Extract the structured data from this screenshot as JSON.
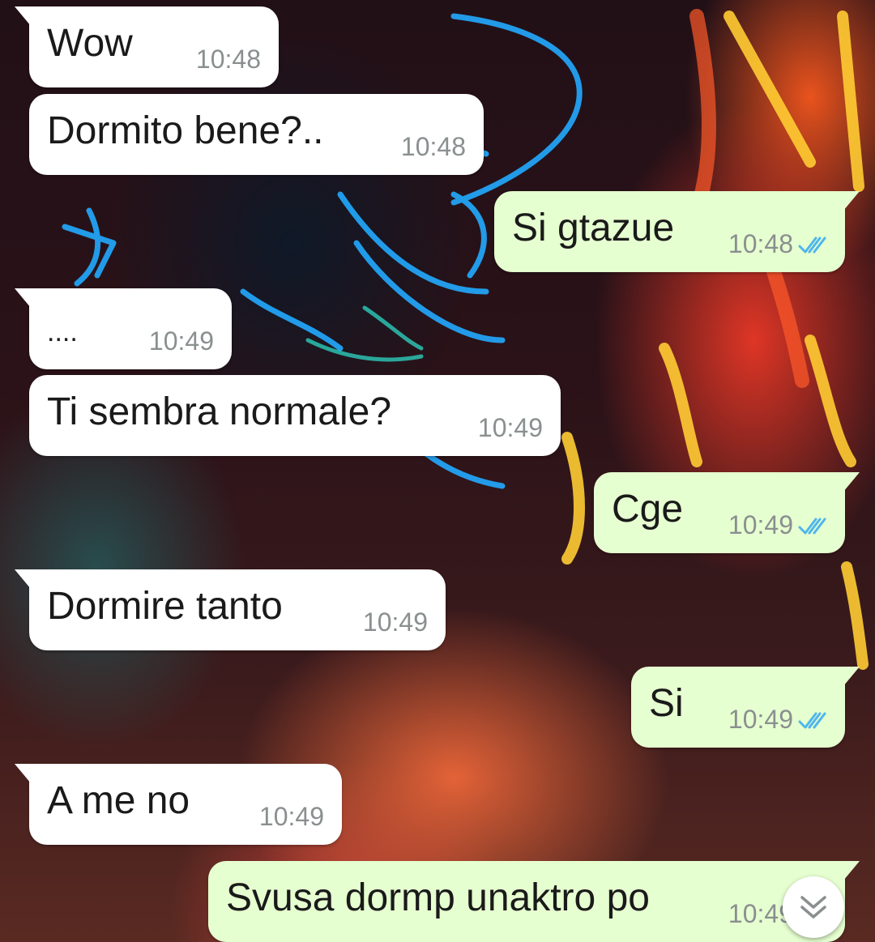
{
  "chat": {
    "messages": [
      {
        "direction": "in",
        "text": "Wow",
        "time": "10:48"
      },
      {
        "direction": "in",
        "text": "Dormito bene?..",
        "time": "10:48"
      },
      {
        "direction": "out",
        "text": "Si gtazue",
        "time": "10:48",
        "status": "read"
      },
      {
        "direction": "in",
        "text": "....",
        "time": "10:49"
      },
      {
        "direction": "in",
        "text": "Ti sembra normale?",
        "time": "10:49"
      },
      {
        "direction": "out",
        "text": "Cge",
        "time": "10:49",
        "status": "read"
      },
      {
        "direction": "in",
        "text": "Dormire tanto",
        "time": "10:49"
      },
      {
        "direction": "out",
        "text": "Si",
        "time": "10:49",
        "status": "read"
      },
      {
        "direction": "in",
        "text": "A me no",
        "time": "10:49"
      },
      {
        "direction": "out",
        "text": "Svusa dormp unaktro po",
        "time": "10:49",
        "status": "read"
      }
    ]
  },
  "icons": {
    "read_receipt": "double-check-icon",
    "scroll_down": "chevron-double-down-icon"
  },
  "colors": {
    "incoming_bubble": "#ffffff",
    "outgoing_bubble": "#e6ffd0",
    "read_tick": "#4fb6ec",
    "timestamp": "#8a8f90"
  }
}
